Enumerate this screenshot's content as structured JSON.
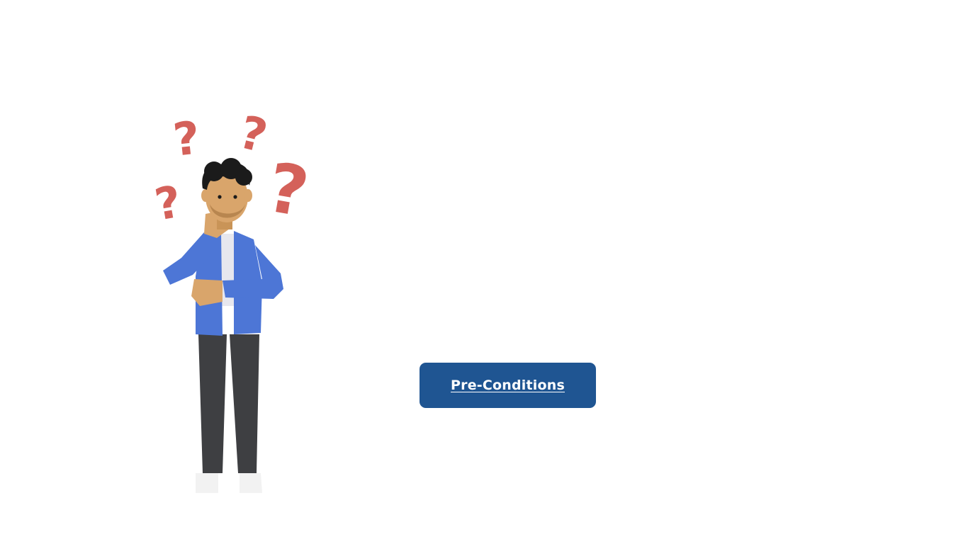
{
  "main": {
    "button_label": "Pre-Conditions"
  },
  "illustration": {
    "icon": "thinking-person-icon",
    "question_mark_icon": "question-mark-icon"
  },
  "colors": {
    "button_bg": "#1f5592",
    "button_text": "#ffffff",
    "question_marks": "#d4615a",
    "jacket": "#4d76d6",
    "pants": "#3e3f42",
    "skin": "#d9a56b",
    "hair": "#1b1b1b"
  }
}
